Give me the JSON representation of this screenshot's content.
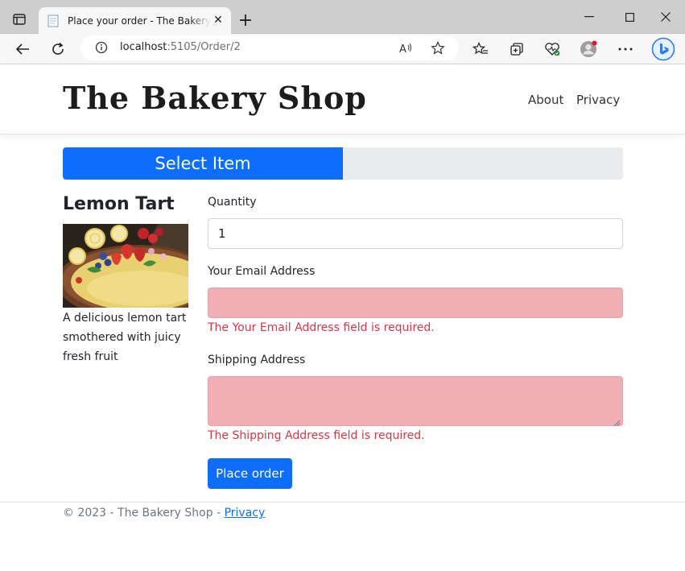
{
  "browser": {
    "tab_title": "Place your order - The Bakery Shop",
    "address_host": "localhost",
    "address_path": ":5105/Order/2"
  },
  "header": {
    "brand": "The Bakery Shop",
    "nav": [
      {
        "label": "About"
      },
      {
        "label": "Privacy"
      }
    ]
  },
  "progress": {
    "label": "Select Item",
    "percent": 50
  },
  "item": {
    "name": "Lemon Tart",
    "description": "A delicious lemon tart smothered with juicy fresh fruit"
  },
  "form": {
    "quantity_label": "Quantity",
    "quantity_value": "1",
    "email_label": "Your Email Address",
    "email_value": "",
    "email_error": "The Your Email Address field is required.",
    "shipping_label": "Shipping Address",
    "shipping_value": "",
    "shipping_error": "The Shipping Address field is required.",
    "submit_label": "Place order"
  },
  "footer": {
    "text": "© 2023 - The Bakery Shop - ",
    "link": "Privacy"
  },
  "colors": {
    "primary": "#0d6efd",
    "invalid_bg": "#f1aeb5",
    "error_text": "#dc3545"
  }
}
